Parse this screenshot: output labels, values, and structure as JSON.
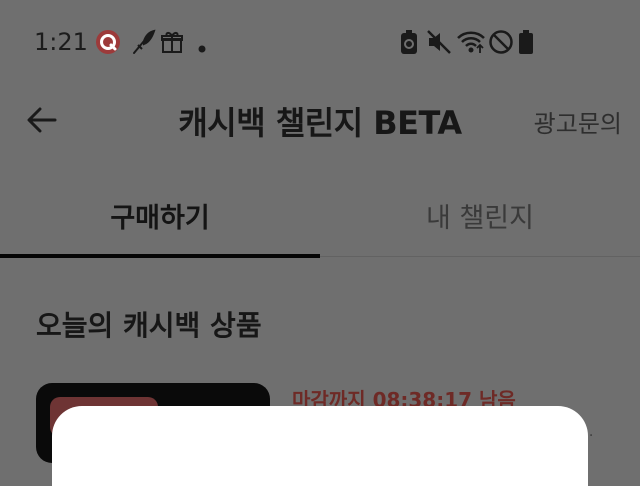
{
  "status_bar": {
    "time": "1:21",
    "left_icons": [
      "app-notification-icon",
      "feather-icon",
      "gift-icon",
      "dot-icon"
    ],
    "right_icons": [
      "battery-saver-icon",
      "mute-icon",
      "wifi-icon",
      "do-not-disturb-icon",
      "battery-icon"
    ]
  },
  "app_bar": {
    "title": "캐시백 챌린지 BETA",
    "ad_inquiry_label": "광고문의",
    "back_icon": "arrow-left-icon"
  },
  "tabs": [
    {
      "label": "구매하기",
      "active": true
    },
    {
      "label": "내 챌린지",
      "active": false
    }
  ],
  "section": {
    "title": "오늘의 캐시백 상품"
  },
  "product": {
    "deadline_text": "마감까지 08:38:17 남음",
    "more_text": "..."
  },
  "colors": {
    "overlay": "#6f6f6f",
    "deadline": "#6e2a26",
    "sheet": "#ffffff"
  }
}
